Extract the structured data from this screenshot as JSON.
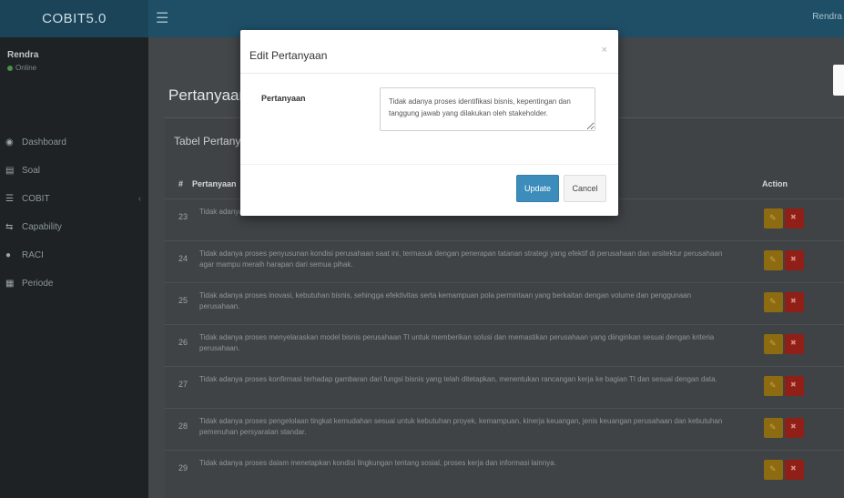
{
  "header": {
    "brand": "COBIT5.0",
    "menu_icon": "hamburger-icon",
    "user_name": "Rendra"
  },
  "sidebar": {
    "user_name": "Rendra",
    "user_status": "Online",
    "nav_header": "",
    "items": [
      {
        "label": "Dashboard",
        "icon": "dashboard-icon"
      },
      {
        "label": "Soal",
        "icon": "file-icon"
      },
      {
        "label": "COBIT",
        "icon": "list-icon"
      },
      {
        "label": "Capability",
        "icon": "chart-icon"
      },
      {
        "label": "RACI",
        "icon": "users-icon"
      },
      {
        "label": "Periode",
        "icon": "calendar-icon"
      }
    ]
  },
  "content": {
    "page_title": "Pertanyaan",
    "panel_title": "Tabel Pertanyaan",
    "table": {
      "col_no": "#",
      "col_question": "Pertanyaan",
      "col_action": "Action",
      "rows": [
        {
          "no": "23",
          "question": "Tidak adanya proses identifikasi bisnis, kepentingan dan tanggung jawab yang dilakukan oleh stakeholder."
        },
        {
          "no": "24",
          "question": "Tidak adanya proses penyusunan kondisi perusahaan saat ini, termasuk dengan penerapan tatanan strategi yang efektif di perusahaan dan arsitektur perusahaan agar mampu meraih harapan dari semua pihak."
        },
        {
          "no": "25",
          "question": "Tidak adanya proses inovasi, kebutuhan bisnis, sehingga efektivitas serta kemampuan pola permintaan yang berkaitan dengan volume dan penggunaan perusahaan."
        },
        {
          "no": "26",
          "question": "Tidak adanya proses menyelaraskan model bisnis perusahaan TI untuk memberikan solusi dan memastikan perusahaan yang diinginkan sesuai dengan kriteria perusahaan."
        },
        {
          "no": "27",
          "question": "Tidak adanya proses konfirmasi terhadap gambaran dari fungsi bisnis yang telah ditetapkan, menentukan rancangan kerja ke bagian TI dan sesuai dengan data."
        },
        {
          "no": "28",
          "question": "Tidak adanya proses pengelolaan tingkat kemudahan sesuai untuk kebutuhan proyek, kemampuan, kinerja keuangan, jenis keuangan perusahaan dan kebutuhan pemenuhan persyaratan standar."
        },
        {
          "no": "29",
          "question": "Tidak adanya proses dalam menetapkan kondisi lingkungan tentang sosial, proses kerja dan informasi lainnya."
        }
      ]
    }
  },
  "modal": {
    "title": "Edit Pertanyaan",
    "close_label": "×",
    "field_label": "Pertanyaan",
    "field_value": "Tidak adanya proses identifikasi bisnis, kepentingan dan tanggung jawab yang dilakukan oleh stakeholder.",
    "update_label": "Update",
    "cancel_label": "Cancel"
  },
  "colors": {
    "header": "#1f4f67",
    "sidebar": "#1e2224",
    "primary": "#3c8dbc",
    "edit_button": "#f39c12",
    "delete_button": "#dd4b39"
  }
}
